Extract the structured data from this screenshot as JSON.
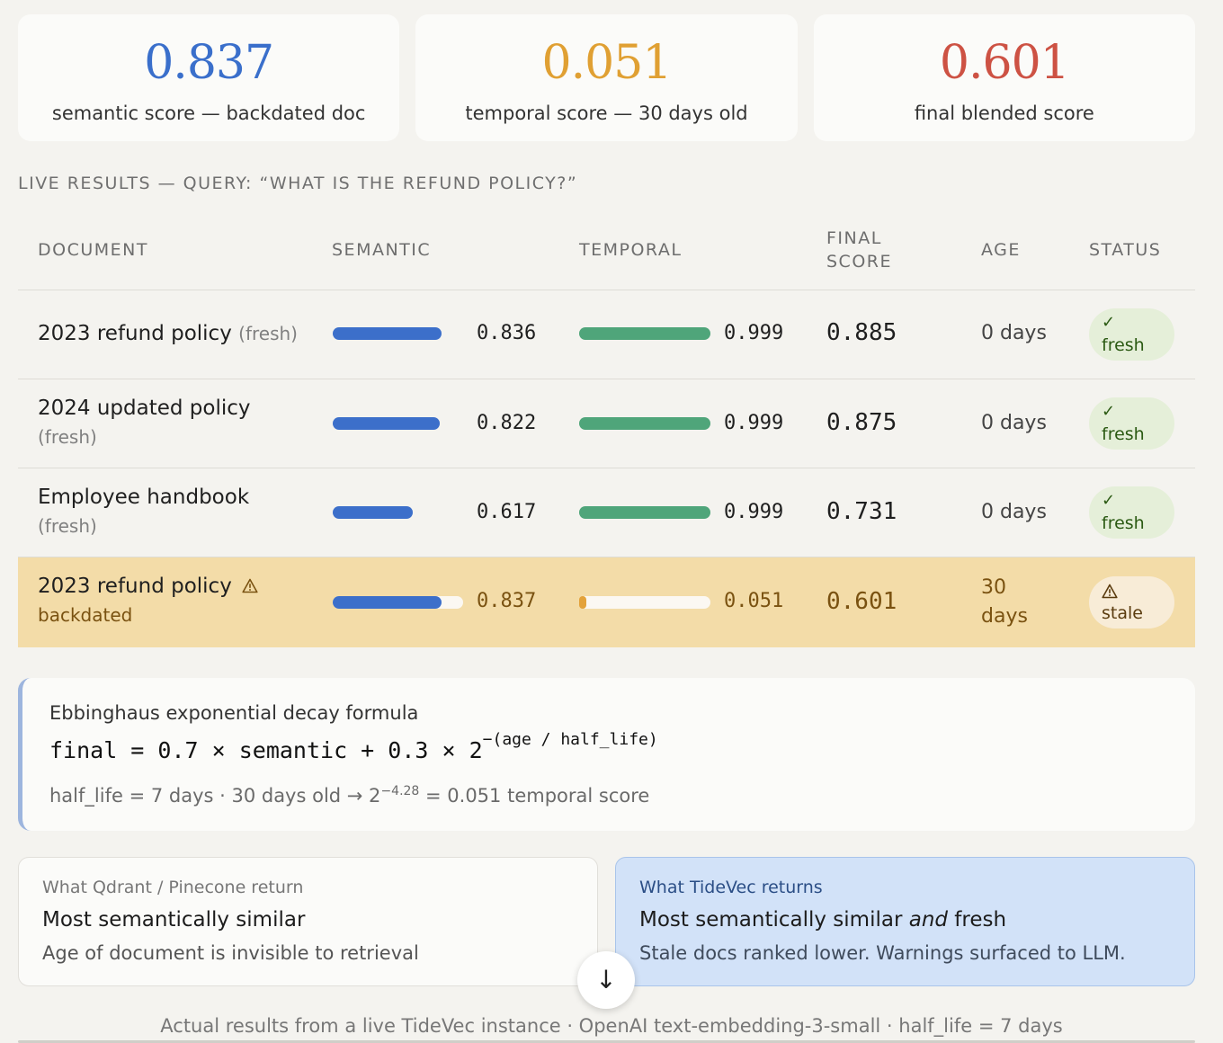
{
  "stats": [
    {
      "value": "0.837",
      "label": "semantic score — backdated doc",
      "color": "#3a6fcb"
    },
    {
      "value": "0.051",
      "label": "temporal score — 30 days old",
      "color": "#e0a033"
    },
    {
      "value": "0.601",
      "label": "final blended score",
      "color": "#cd5244"
    }
  ],
  "section_label": "LIVE RESULTS — QUERY: “WHAT IS THE REFUND POLICY?”",
  "table": {
    "headers": {
      "document": "DOCUMENT",
      "semantic": "SEMANTIC",
      "temporal": "TEMPORAL",
      "final_1": "FINAL",
      "final_2": "SCORE",
      "age": "AGE",
      "status": "STATUS"
    },
    "rows": [
      {
        "doc": "2023 refund policy",
        "tag": "(fresh)",
        "semantic": "0.836",
        "semantic_level": 0.836,
        "temporal": "0.999",
        "temporal_level": 0.999,
        "final": "0.885",
        "age": "0 days",
        "status": "fresh",
        "status_icon": "✓"
      },
      {
        "doc": "2024 updated policy",
        "tag": "(fresh)",
        "semantic": "0.822",
        "semantic_level": 0.822,
        "temporal": "0.999",
        "temporal_level": 0.999,
        "final": "0.875",
        "age": "0 days",
        "status": "fresh",
        "status_icon": "✓"
      },
      {
        "doc": "Employee handbook",
        "tag": "(fresh)",
        "semantic": "0.617",
        "semantic_level": 0.617,
        "temporal": "0.999",
        "temporal_level": 0.999,
        "final": "0.731",
        "age": "0 days",
        "status": "fresh",
        "status_icon": "✓"
      },
      {
        "doc": "2023 refund policy",
        "tag": "backdated",
        "semantic": "0.837",
        "semantic_level": 0.837,
        "temporal": "0.051",
        "temporal_level": 0.051,
        "final": "0.601",
        "age_1": "30",
        "age_2": "days",
        "status": "stale",
        "status_icon": "⚠"
      }
    ]
  },
  "formula": {
    "title": "Ebbinghaus exponential decay formula",
    "eq_main": "final = 0.7 × semantic + 0.3 × 2",
    "eq_exp": "−(age / half_life)",
    "note_pre": "half_life = 7 days  ·  30 days old → 2",
    "note_exp": "−4.28",
    "note_post": " = 0.051 temporal score"
  },
  "compare": {
    "left": {
      "small": "What Qdrant / Pinecone return",
      "head": "Most semantically similar",
      "sub": "Age of document is invisible to retrieval"
    },
    "right": {
      "small": "What TideVec returns",
      "head_1": "Most semantically similar ",
      "head_em": "and",
      "head_2": " fresh",
      "sub": "Stale docs ranked lower. Warnings surfaced to LLM."
    }
  },
  "scroll_icon": "↓",
  "footer": "Actual results from a live TideVec instance · OpenAI text-embedding-3-small · half_life = 7 days",
  "colors": {
    "semantic_bar": "#3c6fca",
    "temporal_bar": "#4fa57a",
    "stale_temporal_bar": "#e3a23a",
    "stale_row": "#f3dca8"
  }
}
